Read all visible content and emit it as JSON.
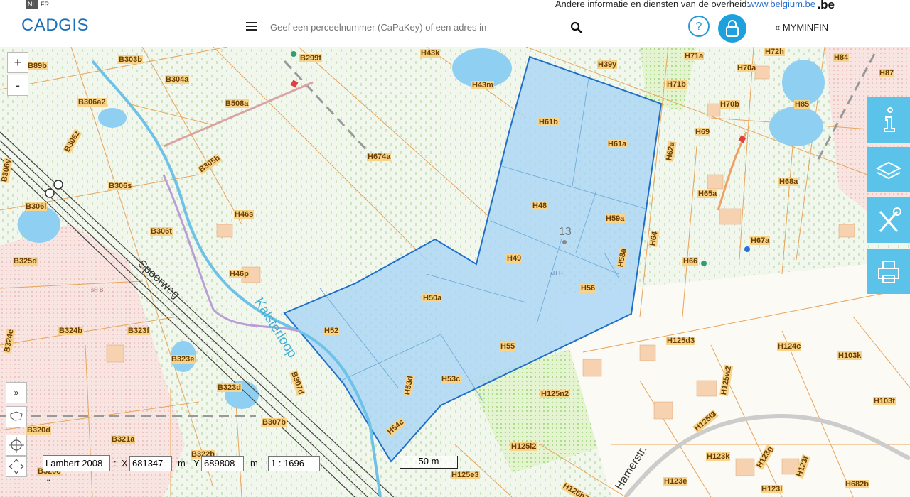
{
  "topbar": {
    "lang_nl": "NL",
    "lang_fr": "FR",
    "gov_text": "Andere informatie en diensten van de overheid:",
    "gov_link": "www.belgium.be",
    "be_logo": ".be"
  },
  "header": {
    "logo": "CADGIS",
    "search_placeholder": "Geef een perceelnummer (CaPaKey) of een adres in",
    "myminfin": "MYMINFIN",
    "menu_icon": "hamburger-icon",
    "search_icon": "search-icon",
    "help_icon": "question-icon",
    "lock_icon": "lock-icon"
  },
  "map": {
    "zoom_in": "+",
    "zoom_out": "-",
    "expand_label": "»",
    "parcels": [
      "B303b",
      "B304a",
      "B299f",
      "H43k",
      "H43m",
      "H39y",
      "H71a",
      "H72h",
      "H84",
      "H87",
      "B306a2",
      "B508a",
      "H70a",
      "H71b",
      "H70b",
      "H85",
      "B306z",
      "B305b",
      "H674a",
      "H61b",
      "H61a",
      "H69",
      "H62a",
      "B306y",
      "B306s",
      "H68a",
      "H65a",
      "B306l",
      "H46s",
      "B306t",
      "H48",
      "H59a",
      "H64",
      "H67a",
      "B325d",
      "H46p",
      "H49",
      "H58a",
      "H66",
      "H50a",
      "H56",
      "B324b",
      "B323f",
      "H52",
      "H55",
      "H125d3",
      "H124c",
      "H103k",
      "B324e",
      "B323e",
      "B307d",
      "H53d",
      "H53c",
      "H125w2",
      "B323d",
      "H125n2",
      "H103t",
      "B320d",
      "B307b",
      "H125f3",
      "B321a",
      "H54c",
      "H125l2",
      "H123k",
      "H123g",
      "H123f",
      "B320c",
      "H125e3",
      "H125h2",
      "H123e",
      "H123l",
      "H682b",
      "B89b",
      "B322b"
    ],
    "selected_parcel_number": "13",
    "street_spoorweg": "Spoorweg",
    "water_kalsterloop": "Kalsterloop",
    "street_hamerstr": "Hamerstr.",
    "small_markers": [
      "sH B",
      "sH H"
    ]
  },
  "sidebar_tools": [
    "info-icon",
    "layers-icon",
    "tools-icon",
    "print-icon"
  ],
  "left_tools": [
    "expand-icon",
    "belgium-map-icon",
    "locate-icon",
    "move-icon"
  ],
  "coords": {
    "projection": "Lambert 2008",
    "x_label": "X",
    "x_value": "681347",
    "y_prefix": "m - Y",
    "y_value": "689808",
    "y_unit": "m",
    "scale": "1 : 1696",
    "scalebar": "50 m",
    "colon": ":"
  },
  "colors": {
    "brand_blue": "#1d6fb8",
    "accent": "#1ea0dc",
    "selection_fill": "#a8d5f5",
    "selection_stroke": "#1f6fc9",
    "tool_panel": "#5bc3ea",
    "label": "#6b3d00",
    "parcel_line": "#e8a45a"
  }
}
